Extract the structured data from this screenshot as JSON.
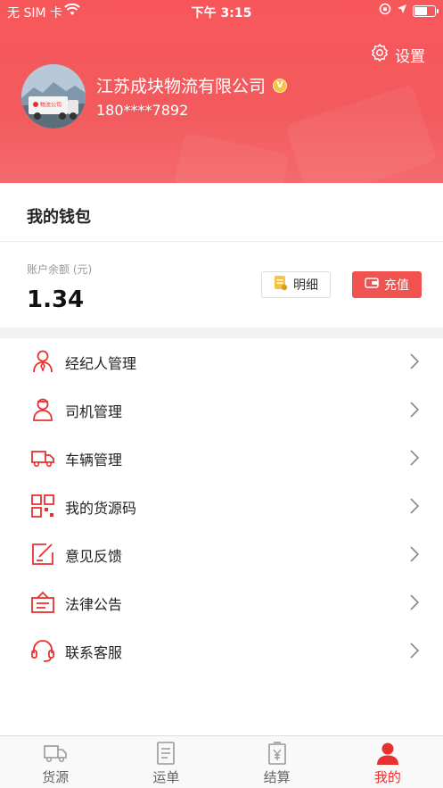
{
  "status_bar": {
    "carrier": "无 SIM 卡",
    "time": "下午 3:15"
  },
  "header": {
    "settings_label": "设置",
    "company_name": "江苏成块物流有限公司",
    "verified_badge": "V",
    "phone": "180****7892",
    "avatar_truck_text": "物流公司"
  },
  "wallet": {
    "title": "我的钱包",
    "balance_label": "账户余额 (元)",
    "balance_value": "1.34",
    "detail_button": "明细",
    "recharge_button": "充值"
  },
  "menu": {
    "items": [
      {
        "label": "经纪人管理",
        "icon": "broker-icon"
      },
      {
        "label": "司机管理",
        "icon": "driver-icon"
      },
      {
        "label": "车辆管理",
        "icon": "truck-icon"
      },
      {
        "label": "我的货源码",
        "icon": "qrcode-icon"
      },
      {
        "label": "意见反馈",
        "icon": "feedback-icon"
      },
      {
        "label": "法律公告",
        "icon": "announcement-icon"
      },
      {
        "label": "联系客服",
        "icon": "headset-icon"
      }
    ]
  },
  "tabbar": {
    "tabs": [
      {
        "label": "货源",
        "icon": "truck-tab-icon",
        "active": false
      },
      {
        "label": "运单",
        "icon": "document-tab-icon",
        "active": false
      },
      {
        "label": "结算",
        "icon": "yuan-tab-icon",
        "active": false
      },
      {
        "label": "我的",
        "icon": "person-tab-icon",
        "active": true
      }
    ]
  },
  "colors": {
    "brand_red": "#f35a5d",
    "accent_red": "#e8312f",
    "badge_gold": "#f6c343"
  }
}
